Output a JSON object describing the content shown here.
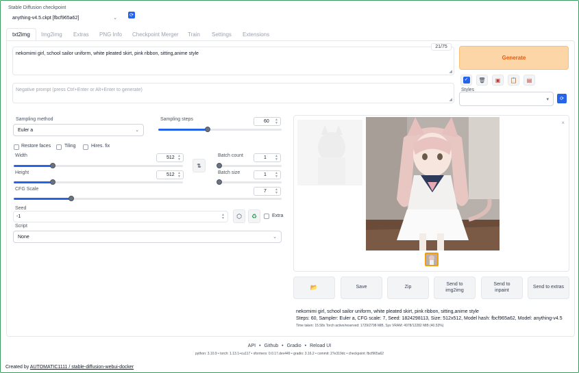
{
  "checkpoint": {
    "label": "Stable Diffusion checkpoint",
    "value": "anything-v4.5.ckpt [fbcf965a62]"
  },
  "tabs": [
    "txt2img",
    "Img2img",
    "Extras",
    "PNG Info",
    "Checkpoint Merger",
    "Train",
    "Settings",
    "Extensions"
  ],
  "prompt": {
    "value": "nekomimi girl, school sailor uniform, white pleated skirt, pink ribbon, sitting,anime style",
    "counter": "21/75"
  },
  "negative_prompt": {
    "placeholder": "Negative prompt (press Ctrl+Enter or Alt+Enter to generate)"
  },
  "generate_label": "Generate",
  "styles_label": "Styles",
  "sampling": {
    "method_label": "Sampling method",
    "method_value": "Euler a",
    "steps_label": "Sampling steps",
    "steps_value": "60",
    "steps_fraction": 0.4
  },
  "options": {
    "restore_faces": "Restore faces",
    "tiling": "Tiling",
    "hires_fix": "Hires. fix"
  },
  "width": {
    "label": "Width",
    "value": "512"
  },
  "height": {
    "label": "Height",
    "value": "512"
  },
  "batch_count": {
    "label": "Batch count",
    "value": "1"
  },
  "batch_size": {
    "label": "Batch size",
    "value": "1"
  },
  "cfg": {
    "label": "CFG Scale",
    "value": "7"
  },
  "seed": {
    "label": "Seed",
    "value": "-1",
    "extra_label": "Extra"
  },
  "script": {
    "label": "Script",
    "value": "None"
  },
  "output_buttons": {
    "save": "Save",
    "zip": "Zip",
    "send_img2img": "Send to img2img",
    "send_inpaint": "Send to inpaint",
    "send_extras": "Send to extras"
  },
  "result": {
    "prompt": "nekomimi girl, school sailor uniform, white pleated skirt, pink ribbon, sitting,anime style",
    "params": "Steps: 60, Sampler: Euler a, CFG scale: 7, Seed: 1824298113, Size: 512x512, Model hash: fbcf965a62, Model: anything-v4.5",
    "time": "Time taken: 15.58s  Torch active/reserved: 1729/2798 MiB, Sys VRAM: 4978/12282 MiB (40.53%)"
  },
  "footer": {
    "links": [
      "API",
      "Github",
      "Gradio",
      "Reload UI"
    ],
    "versions": "python: 3.10.9  •  torch: 1.13.1+cu117  •  xformers: 0.0.17.dev449  •  gradio: 3.16.2  •  commit: 27e319dc  •  checkpoint: fbcf965a62",
    "created_prefix": "Created by ",
    "created_link": "AUTOMATIC1111 / stable-diffusion-webui-docker"
  },
  "colors": {
    "accent": "#2563eb",
    "generate_bg": "#fdd6a8",
    "generate_text": "#ea580c",
    "frame": "#3a9a5b"
  }
}
